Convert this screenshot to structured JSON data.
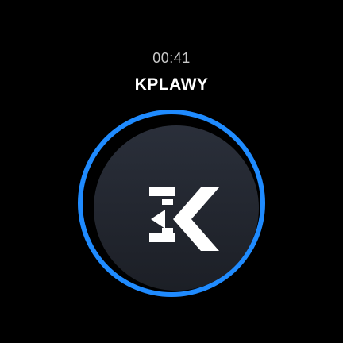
{
  "status": {
    "time": "00:41"
  },
  "header": {
    "title": "KPLAWY"
  },
  "logo": {
    "icon": "ek-logo-icon",
    "ring_color": "#1f8bff",
    "background_color": "#22262f"
  }
}
